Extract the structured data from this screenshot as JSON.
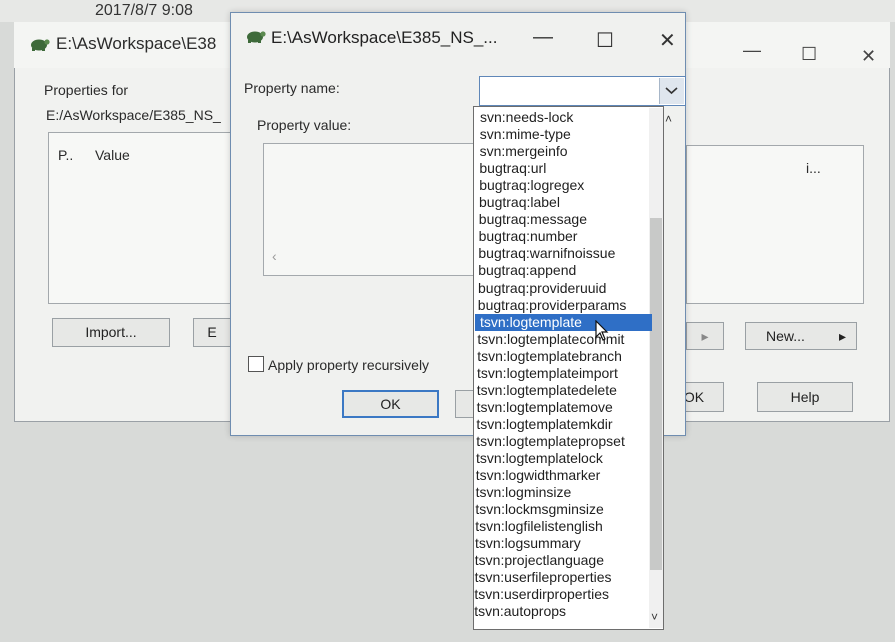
{
  "taskbar": {
    "datetime": "2017/8/7 9:08"
  },
  "background_window": {
    "title": "E:\\AsWorkspace\\E38",
    "properties_for_label": "Properties for",
    "path": "E:/AsWorkspace/E385_NS_",
    "columns": [
      "P..",
      "Value",
      "i..."
    ],
    "buttons": {
      "import": "Import...",
      "edit_fragment": "E",
      "new": "New...",
      "ok_fragment": "OK",
      "help": "Help"
    },
    "controls": {
      "minimize": "—",
      "maximize": "☐",
      "close": "✕"
    }
  },
  "dialog": {
    "title": "E:\\AsWorkspace\\E385_NS_...",
    "controls": {
      "minimize": "—",
      "maximize": "☐",
      "close": "✕"
    },
    "property_name_label": "Property name:",
    "property_name_value": "",
    "property_value_label": "Property value:",
    "apply_recursively_label": "Apply property recursively",
    "ok_label": "OK",
    "scroll_left_glyph": "‹"
  },
  "dropdown": {
    "selected_index": 12,
    "items": [
      "svn:needs-lock",
      "svn:mime-type",
      "svn:mergeinfo",
      "bugtraq:url",
      "bugtraq:logregex",
      "bugtraq:label",
      "bugtraq:message",
      "bugtraq:number",
      "bugtraq:warnifnoissue",
      "bugtraq:append",
      "bugtraq:provideruuid",
      "bugtraq:providerparams",
      "tsvn:logtemplate",
      "tsvn:logtemplatecommit",
      "tsvn:logtemplatebranch",
      "tsvn:logtemplateimport",
      "tsvn:logtemplatedelete",
      "tsvn:logtemplatemove",
      "tsvn:logtemplatemkdir",
      "tsvn:logtemplatepropset",
      "tsvn:logtemplatelock",
      "tsvn:logwidthmarker",
      "tsvn:logminsize",
      "tsvn:lockmsgminsize",
      "tsvn:logfilelistenglish",
      "tsvn:logsummary",
      "tsvn:projectlanguage",
      "tsvn:userfileproperties",
      "tsvn:userdirproperties",
      "tsvn:autoprops"
    ],
    "scroll_up_glyph": "˄",
    "scroll_down_glyph": "˅"
  },
  "colors": {
    "selection": "#2f6fc6",
    "dialog_border": "#6f8db0",
    "background": "#d8dad8"
  }
}
